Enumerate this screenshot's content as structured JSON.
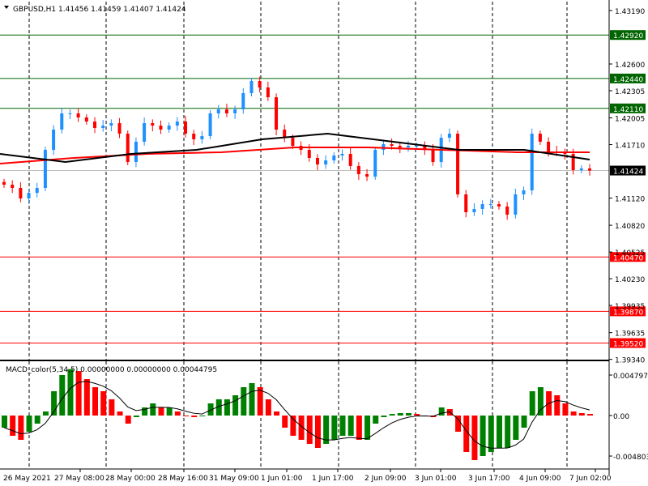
{
  "chart_data": {
    "type": "candlestick",
    "title": "GBPUSD,H1",
    "ohlc_header": [
      "1.41456",
      "1.41459",
      "1.41407",
      "1.41424"
    ],
    "current_price": "1.41424",
    "price_ticks": [
      "1.43190",
      "1.42600",
      "1.42305",
      "1.42005",
      "1.41710",
      "1.41120",
      "1.40820",
      "1.40525",
      "1.40230",
      "1.39935",
      "1.39635",
      "1.39340"
    ],
    "ylim": [
      1.393,
      1.433
    ],
    "levels": [
      {
        "value": 1.4292,
        "label": "1.42920",
        "color": "#006400"
      },
      {
        "value": 1.4244,
        "label": "1.42440",
        "color": "#006400"
      },
      {
        "value": 1.4211,
        "label": "1.42110",
        "color": "#006400"
      },
      {
        "value": 1.4047,
        "label": "1.40470",
        "color": "#ff0000"
      },
      {
        "value": 1.3987,
        "label": "1.39870",
        "color": "#ff0000"
      },
      {
        "value": 1.3952,
        "label": "1.39520",
        "color": "#ff0000"
      }
    ],
    "closes": [
      1.41268,
      1.41232,
      1.41116,
      1.41178,
      1.41232,
      1.41652,
      1.41876,
      1.42055,
      1.42055,
      1.4201,
      1.41965,
      1.41894,
      1.4192,
      1.41947,
      1.41831,
      1.41518,
      1.41742,
      1.41947,
      1.4192,
      1.41876,
      1.4192,
      1.41965,
      1.41831,
      1.41769,
      1.41804,
      1.42055,
      1.42099,
      1.42055,
      1.42099,
      1.42278,
      1.42412,
      1.42341,
      1.42233,
      1.41876,
      1.41786,
      1.41697,
      1.41652,
      1.41563,
      1.41491,
      1.41536,
      1.4159,
      1.41608,
      1.41474,
      1.41384,
      1.41357,
      1.41652,
      1.41715,
      1.41697,
      1.41679,
      1.41697,
      1.41697,
      1.41652,
      1.41518,
      1.41786,
      1.41831,
      1.41161,
      1.40964,
      1.41,
      1.41053,
      1.41053,
      1.41027,
      1.40937,
      1.41161,
      1.41205,
      1.41831,
      1.41742,
      1.41634,
      1.41625,
      1.41608,
      1.41429,
      1.41447,
      1.41424
    ],
    "ma_black": [
      1.41608,
      1.41518,
      1.41608,
      1.41652,
      1.41769,
      1.41831,
      1.41742,
      1.41652,
      1.41652,
      1.41545
    ],
    "ma_red": [
      1.415,
      1.41563,
      1.41608,
      1.41626,
      1.41679,
      1.41679,
      1.41652,
      1.41626,
      1.41626
    ],
    "macd": {
      "label": "MACD_color(5,34,5) 0.00000000 0.00000000 0.00044795",
      "ticks": [
        "0.0047972",
        "0.00",
        "-0.004803"
      ],
      "ylim": [
        -0.0054,
        0.006
      ],
      "histogram": [
        -0.00144,
        -0.0024,
        -0.00288,
        -0.00192,
        -0.00096,
        0.00048,
        0.00288,
        0.0048,
        0.0055,
        0.00528,
        0.00432,
        0.00336,
        0.00288,
        0.00192,
        0.00048,
        -0.00096,
        -0.00019,
        0.00096,
        0.00144,
        0.00096,
        0.00096,
        0.00048,
        0,
        -0.00019,
        0,
        0.00144,
        0.00192,
        0.00192,
        0.0024,
        0.00336,
        0.00384,
        0.00336,
        0.00192,
        0.00048,
        -0.00144,
        -0.0024,
        -0.00288,
        -0.00336,
        -0.00384,
        -0.00336,
        -0.00288,
        -0.0024,
        -0.0024,
        -0.00288,
        -0.00288,
        -0.00096,
        -0.00019,
        0.00019,
        0.00029,
        0.00029,
        0.00019,
        0,
        -0.00019,
        0.00096,
        0.00077,
        -0.00192,
        -0.00432,
        -0.00528,
        -0.0048,
        -0.00432,
        -0.00384,
        -0.00384,
        -0.00288,
        -0.00144,
        0.00288,
        0.00336,
        0.00288,
        0.0024,
        0.00144,
        0.00048,
        0.00029,
        0.00019
      ]
    },
    "time_labels": [
      "26 May 2021",
      "27 May 08:00",
      "28 May 00:00",
      "28 May 16:00",
      "31 May 09:00",
      "1 Jun 01:00",
      "1 Jun 17:00",
      "2 Jun 09:00",
      "3 Jun 01:00",
      "3 Jun 17:00",
      "4 Jun 09:00",
      "7 Jun 02:00"
    ],
    "colors": {
      "bull": "#1e90ff",
      "bear": "#ff0000",
      "hist_up": "#008000",
      "hist_down": "#ff0000",
      "current": "#000000"
    }
  }
}
